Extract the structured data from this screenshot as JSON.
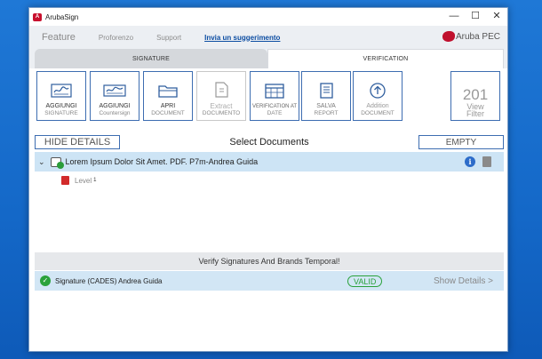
{
  "window": {
    "title": "ArubaSign",
    "app_icon_text": "A",
    "controls": [
      "—",
      "☐",
      "✕"
    ]
  },
  "menu": {
    "items": [
      "Feature",
      "Proforenzo",
      "Support"
    ],
    "suggestion_link": "Invia un suggerimento",
    "brand": "Aruba PEC"
  },
  "tabs": {
    "signature": "SIGNATURE",
    "verification": "VERIFICATION"
  },
  "toolbar": {
    "buttons": [
      {
        "l1": "AGGIUNGI",
        "l2": "SIGNATURE",
        "icon": "signature-icon"
      },
      {
        "l1": "AGGIUNGI",
        "l2": "Countersign",
        "icon": "countersign-icon"
      },
      {
        "l1": "APRI",
        "l2": "DOCUMENT",
        "icon": "folder-icon"
      },
      {
        "l1": "Extract",
        "l2": "DOCUMENTO",
        "icon": "extract-icon",
        "disabled": true
      },
      {
        "l1": "VERIFICATION AT",
        "l2": "DATE",
        "icon": "calendar-icon"
      },
      {
        "l1": "SALVA",
        "l2": "REPORT",
        "icon": "report-icon"
      },
      {
        "l1": "Addition",
        "l2": "DOCUMENT",
        "icon": "add-icon"
      },
      {
        "num": "201",
        "l1": "View",
        "l2": "Filter",
        "icon": "filter-icon"
      }
    ]
  },
  "details": {
    "hide_label": "HIDE DETAILS",
    "title": "Select Documents",
    "empty_label": "EMPTY"
  },
  "document": {
    "name": "Lorem Ipsum Dolor Sit Amet. PDF. P7m-Andrea Guida",
    "level_label": "Level",
    "level_num": "1"
  },
  "verification": {
    "header": "Verify Signatures And Brands Temporal!",
    "signature": "Signature (CADES) Andrea Guida",
    "status": "VALID",
    "show_details": "Show Details >"
  }
}
